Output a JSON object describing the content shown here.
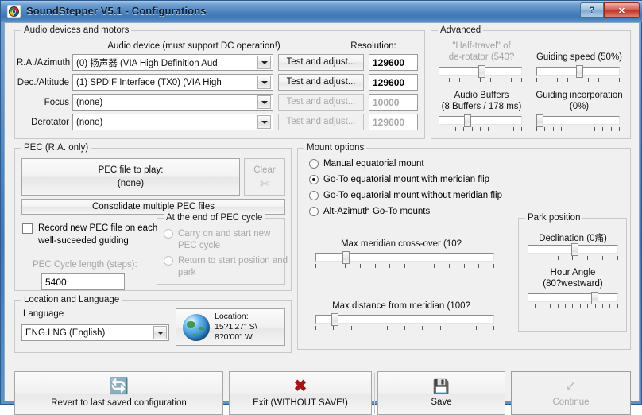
{
  "window": {
    "title": "SoundStepper V5.1 - Configurations",
    "icon": "app-icon",
    "help_button": "?",
    "close_button": "✕"
  },
  "audio_group": {
    "title": "Audio devices and motors",
    "column_device": "Audio device (must support DC operation!)",
    "column_resolution": "Resolution:",
    "rows": [
      {
        "label": "R.A./Azimuth",
        "device": "(0) 扬声器 (VIA High Definition Aud",
        "button": "Test and adjust...",
        "resolution": "129600",
        "enabled": true
      },
      {
        "label": "Dec./Altitude",
        "device": "(1) SPDIF Interface (TX0) (VIA High",
        "button": "Test and adjust...",
        "resolution": "129600",
        "enabled": true
      },
      {
        "label": "Focus",
        "device": "(none)",
        "button": "Test and adjust...",
        "resolution": "10000",
        "enabled": false
      },
      {
        "label": "Derotator",
        "device": "(none)",
        "button": "Test and adjust...",
        "resolution": "129600",
        "enabled": false
      }
    ]
  },
  "advanced_group": {
    "title": "Advanced",
    "sliders": [
      {
        "label_line1": "\"Half-travel\" of",
        "label_line2": "de-rotator (540?",
        "value_pct": 50,
        "ticks": 9,
        "enabled": false
      },
      {
        "label_line1": "Guiding speed (50%)",
        "label_line2": "",
        "value_pct": 50,
        "ticks": 9,
        "enabled": true
      },
      {
        "label_line1": "Audio Buffers",
        "label_line2": "(8 Buffers / 178 ms)",
        "value_pct": 33,
        "ticks": 11,
        "enabled": true
      },
      {
        "label_line1": "Guiding incorporation",
        "label_line2": "(0%)",
        "value_pct": 2,
        "ticks": 11,
        "enabled": true
      }
    ]
  },
  "pec_group": {
    "title": "PEC (R.A. only)",
    "file_button_line1": "PEC file to play:",
    "file_button_line2": "(none)",
    "clear_button": "Clear",
    "clear_icon": "scissors-icon",
    "consolidate_button": "Consolidate multiple PEC files",
    "record_checkbox_line1": "Record new PEC file on each",
    "record_checkbox_line2": "well-suceeded guiding",
    "record_checked": false,
    "cycle_length_label": "PEC Cycle length (steps):",
    "cycle_length_value": "5400",
    "end_group": {
      "title": "At the end of PEC cycle",
      "options": [
        {
          "label_line1": "Carry on and start new",
          "label_line2": "PEC cycle",
          "selected": false
        },
        {
          "label_line1": "Return to start position and",
          "label_line2": "park",
          "selected": false
        }
      ]
    }
  },
  "mount_group": {
    "title": "Mount options",
    "options": [
      {
        "label": "Manual equatorial mount",
        "selected": false
      },
      {
        "label": "Go-To equatorial mount with meridian flip",
        "selected": true
      },
      {
        "label": "Go-To equatorial mount without meridian flip",
        "selected": false
      },
      {
        "label": "Alt-Azimuth Go-To mounts",
        "selected": false
      }
    ],
    "sliders": [
      {
        "label": "Max meridian cross-over (10?",
        "value_pct": 17,
        "ticks": 13
      },
      {
        "label": "Max distance from meridian (100?",
        "value_pct": 11,
        "ticks": 11
      }
    ],
    "park_group": {
      "title": "Park position",
      "sliders": [
        {
          "label_line1": "Declination (0痛)",
          "label_line2": "",
          "value_pct": 50,
          "ticks": 7
        },
        {
          "label_line1": "Hour Angle",
          "label_line2": "(80?westward)",
          "value_pct": 72,
          "ticks": 13
        }
      ]
    }
  },
  "location_group": {
    "title": "Location and Language",
    "language_label": "Language",
    "language_value": "ENG.LNG (English)",
    "globe_icon": "globe-icon",
    "location_line1": "Location:",
    "location_line2": "15?1'27\" S\\",
    "location_line3": "8?0'00\" W"
  },
  "toolbar": {
    "revert_label": "Revert to last saved configuration",
    "revert_icon": "refresh-icon",
    "exit_label": "Exit (WITHOUT SAVE!)",
    "exit_icon": "x-icon",
    "save_label": "Save",
    "save_icon": "floppy-disk-icon",
    "continue_label": "Continue",
    "continue_icon": "checkmark-icon"
  },
  "colors": {
    "accent_blue": "#3d76b5",
    "green": "#19a33a",
    "red": "#a31419",
    "save_blue": "#2a7fc4",
    "face": "#f0f0f0"
  }
}
